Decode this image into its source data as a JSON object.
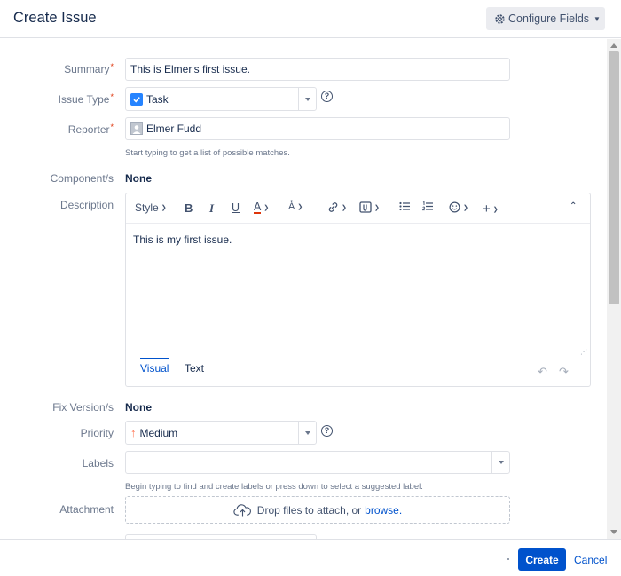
{
  "dialog": {
    "title": "Create Issue",
    "configure_fields_label": "Configure Fields"
  },
  "fields": {
    "summary": {
      "label": "Summary",
      "required": "*",
      "value": "This is Elmer's first issue."
    },
    "issue_type": {
      "label": "Issue Type",
      "required": "*",
      "value": "Task"
    },
    "reporter": {
      "label": "Reporter",
      "required": "*",
      "value": "Elmer Fudd",
      "hint": "Start typing to get a list of possible matches."
    },
    "components": {
      "label": "Component/s",
      "value": "None"
    },
    "description": {
      "label": "Description",
      "toolbar": {
        "style_label": "Style"
      },
      "value": "This is my first issue.",
      "tabs": [
        {
          "label": "Visual"
        },
        {
          "label": "Text"
        }
      ]
    },
    "fix_versions": {
      "label": "Fix Version/s",
      "value": "None"
    },
    "priority": {
      "label": "Priority",
      "value": "Medium"
    },
    "labels": {
      "label": "Labels",
      "value": "",
      "hint": "Begin typing to find and create labels or press down to select a suggested label."
    },
    "attachment": {
      "label": "Attachment",
      "drop_text": "Drop files to attach, or",
      "browse_label": "browse."
    }
  },
  "footer": {
    "create_label": "Create",
    "cancel_label": "Cancel"
  },
  "colors": {
    "primary": "#0052cc",
    "required": "#de350b",
    "task_icon": "#2684ff",
    "priority_medium": "#ff7452"
  },
  "icons": [
    "gear-icon",
    "chevron-down-icon",
    "help-icon",
    "task-checkbox-icon",
    "avatar-icon",
    "bold-icon",
    "italic-icon",
    "underline-icon",
    "text-color-icon",
    "link-icon",
    "attachment-icon",
    "bullet-list-icon",
    "numbered-list-icon",
    "emoji-icon",
    "insert-more-icon",
    "collapse-icon",
    "undo-icon",
    "redo-icon",
    "upload-cloud-icon",
    "priority-arrow-up-icon"
  ]
}
